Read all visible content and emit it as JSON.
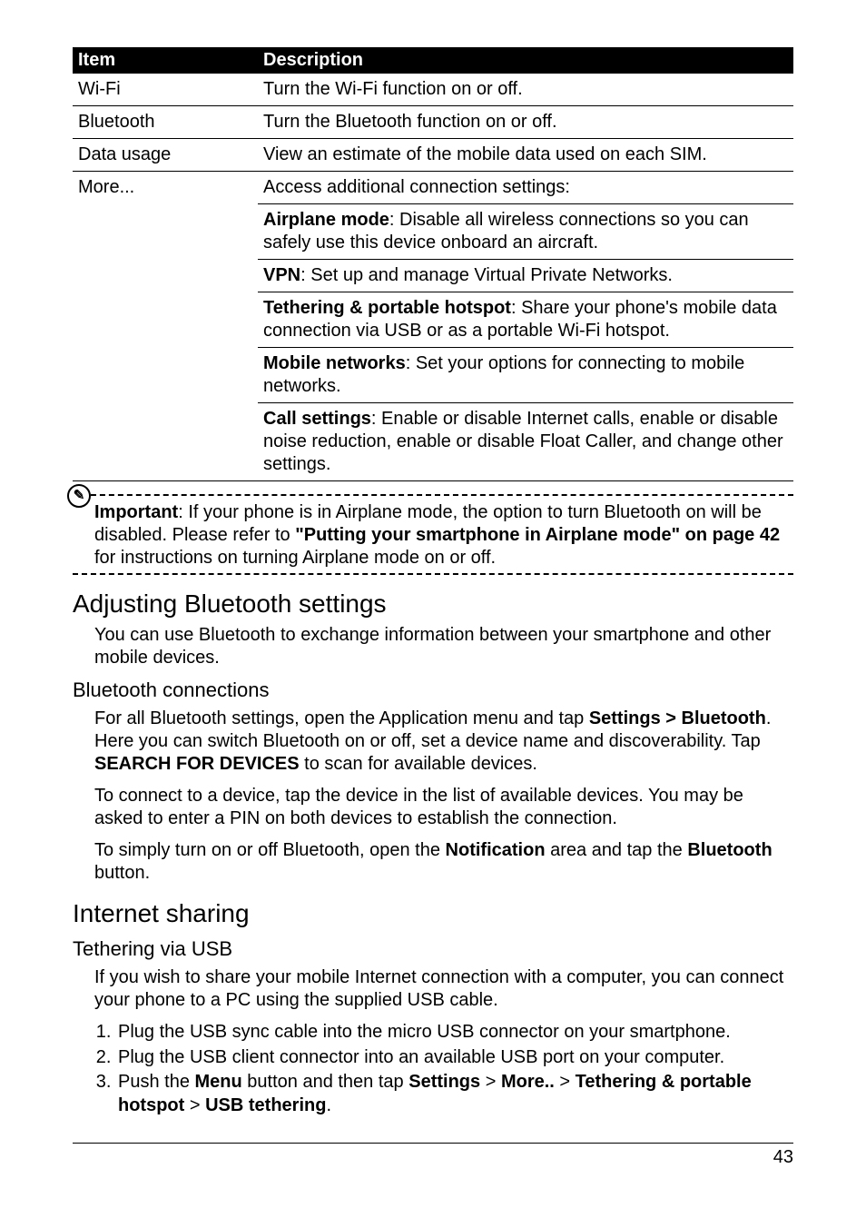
{
  "table": {
    "headers": {
      "item": "Item",
      "desc": "Description"
    },
    "rows": [
      {
        "item": "Wi-Fi",
        "desc": "Turn the Wi-Fi function on or off."
      },
      {
        "item": "Bluetooth",
        "desc": "Turn the Bluetooth function on or off."
      },
      {
        "item": "Data usage",
        "desc": "View an estimate of the mobile data used on each SIM."
      }
    ],
    "more": {
      "item": "More...",
      "lead": "Access additional connection settings:",
      "entries": [
        {
          "term": "Airplane mode",
          "rest": ": Disable all wireless connections so you can safely use this device onboard an aircraft."
        },
        {
          "term": "VPN",
          "rest": ": Set up and manage Virtual Private Networks."
        },
        {
          "term": "Tethering & portable hotspot",
          "rest": ": Share your phone's mobile data connection via USB or as a portable Wi-Fi hotspot."
        },
        {
          "term": "Mobile networks",
          "rest": ": Set your options for connecting to mobile networks."
        },
        {
          "term": "Call settings",
          "rest": ": Enable or disable Internet calls, enable or disable noise reduction, enable or disable Float Caller, and change other settings."
        }
      ]
    }
  },
  "important": {
    "icon": "✎",
    "label": "Important",
    "before": ": If your phone is in Airplane mode, the option to turn Bluetooth on will be disabled. Please refer to ",
    "ref": "\"Putting your smartphone in Airplane mode\" on page 42",
    "after": " for instructions on turning Airplane mode on or off."
  },
  "sections": {
    "bt_heading": "Adjusting Bluetooth settings",
    "bt_intro": "You can use Bluetooth to exchange information between your smartphone and other mobile devices.",
    "bt_conn_heading": "Bluetooth connections",
    "bt_conn_p1_a": "For all Bluetooth settings, open the Application menu and tap ",
    "bt_conn_p1_b": "Settings > Bluetooth",
    "bt_conn_p1_c": ". Here you can switch Bluetooth on or off, set a device name and discoverability. Tap ",
    "bt_conn_p1_d": "SEARCH FOR DEVICES",
    "bt_conn_p1_e": " to scan for available devices.",
    "bt_conn_p2": "To connect to a device, tap the device in the list of available devices. You may be asked to enter a PIN on both devices to establish the connection.",
    "bt_conn_p3_a": "To simply turn on or off Bluetooth, open the ",
    "bt_conn_p3_b": "Notification",
    "bt_conn_p3_c": " area and tap the ",
    "bt_conn_p3_d": "Bluetooth",
    "bt_conn_p3_e": " button.",
    "is_heading": "Internet sharing",
    "usb_heading": "Tethering via USB",
    "usb_intro": "If you wish to share your mobile Internet connection with a computer, you can connect your phone to a PC using the supplied USB cable.",
    "steps": {
      "s1": "Plug the USB sync cable into the micro USB connector on your smartphone.",
      "s2": "Plug the USB client connector into an available USB port on your computer.",
      "s3_a": "Push the ",
      "s3_b": "Menu",
      "s3_c": " button and then tap ",
      "s3_d": "Settings",
      "s3_e": " > ",
      "s3_f": "More..",
      "s3_g": " > ",
      "s3_h": "Tethering & portable hotspot",
      "s3_i": " > ",
      "s3_j": "USB tethering",
      "s3_k": "."
    }
  },
  "page_number": "43"
}
